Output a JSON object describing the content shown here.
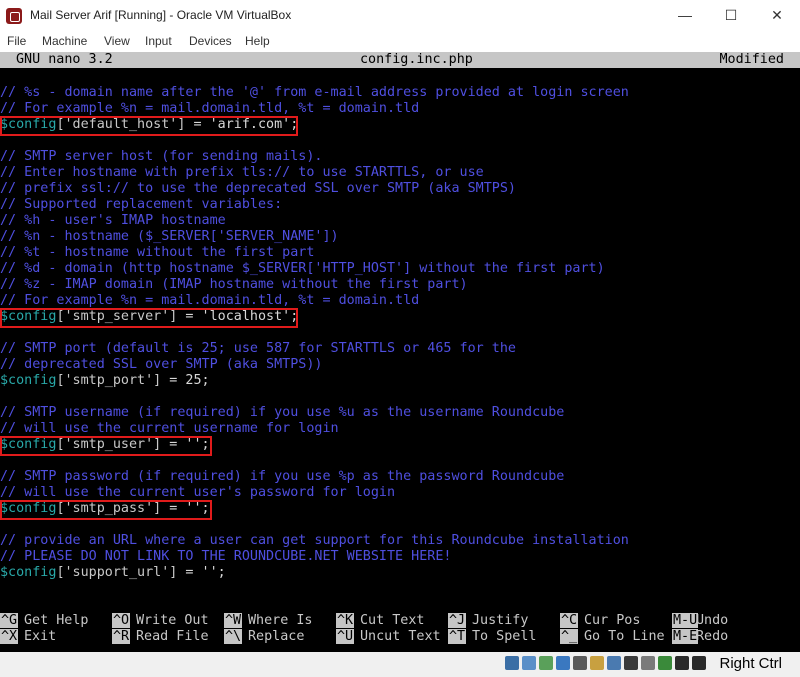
{
  "window": {
    "title": "Mail Server Arif [Running] - Oracle VM VirtualBox",
    "minimize": "—",
    "maximize": "☐",
    "close": "✕"
  },
  "menu": [
    "File",
    "Machine",
    "View",
    "Input",
    "Devices",
    "Help"
  ],
  "nano": {
    "app": "GNU nano 3.2",
    "file": "config.inc.php",
    "status": "Modified"
  },
  "lines": [
    "// %s - domain name after the '@' from e-mail address provided at login screen",
    "// For example %n = mail.domain.tld, %t = domain.tld",
    {
      "var": "$config",
      "key": "['default_host']",
      "rest": " = 'arif.com';"
    },
    "",
    "// SMTP server host (for sending mails).",
    "// Enter hostname with prefix tls:// to use STARTTLS, or use",
    "// prefix ssl:// to use the deprecated SSL over SMTP (aka SMTPS)",
    "// Supported replacement variables:",
    "// %h - user's IMAP hostname",
    "// %n - hostname ($_SERVER['SERVER_NAME'])",
    "// %t - hostname without the first part",
    "// %d - domain (http hostname $_SERVER['HTTP_HOST'] without the first part)",
    "// %z - IMAP domain (IMAP hostname without the first part)",
    "// For example %n = mail.domain.tld, %t = domain.tld",
    {
      "var": "$config",
      "key": "['smtp_server']",
      "rest": " = 'localhost';"
    },
    "",
    "// SMTP port (default is 25; use 587 for STARTTLS or 465 for the",
    "// deprecated SSL over SMTP (aka SMTPS))",
    {
      "var": "$config",
      "key": "['smtp_port']",
      "rest": " = 25;"
    },
    "",
    "// SMTP username (if required) if you use %u as the username Roundcube",
    "// will use the current username for login",
    {
      "var": "$config",
      "key": "['smtp_user']",
      "rest": " = '';"
    },
    "",
    "// SMTP password (if required) if you use %p as the password Roundcube",
    "// will use the current user's password for login",
    {
      "var": "$config",
      "key": "['smtp_pass']",
      "rest": " = '';"
    },
    "",
    "// provide an URL where a user can get support for this Roundcube installation",
    "// PLEASE DO NOT LINK TO THE ROUNDCUBE.NET WEBSITE HERE!",
    {
      "var": "$config",
      "key": "['support_url']",
      "rest": " = '';"
    }
  ],
  "shortcuts": [
    {
      "key": "^G",
      "label": "Get Help"
    },
    {
      "key": "^O",
      "label": "Write Out"
    },
    {
      "key": "^W",
      "label": "Where Is"
    },
    {
      "key": "^K",
      "label": "Cut Text"
    },
    {
      "key": "^J",
      "label": "Justify"
    },
    {
      "key": "^C",
      "label": "Cur Pos"
    },
    {
      "key": "M-U",
      "label": "Undo"
    },
    {
      "key": "^X",
      "label": "Exit"
    },
    {
      "key": "^R",
      "label": "Read File"
    },
    {
      "key": "^\\",
      "label": "Replace"
    },
    {
      "key": "^U",
      "label": "Uncut Text"
    },
    {
      "key": "^T",
      "label": "To Spell"
    },
    {
      "key": "^_",
      "label": "Go To Line"
    },
    {
      "key": "M-E",
      "label": "Redo"
    }
  ],
  "status_icons": [
    "hdd-icon",
    "optical-icon",
    "audio-icon",
    "network-icon",
    "usb-icon",
    "shared-folder-icon",
    "display-icon",
    "recording-icon",
    "vrde-icon",
    "capture-icon",
    "mouse-icon",
    "keyboard-icon"
  ],
  "host_key": "Right Ctrl"
}
